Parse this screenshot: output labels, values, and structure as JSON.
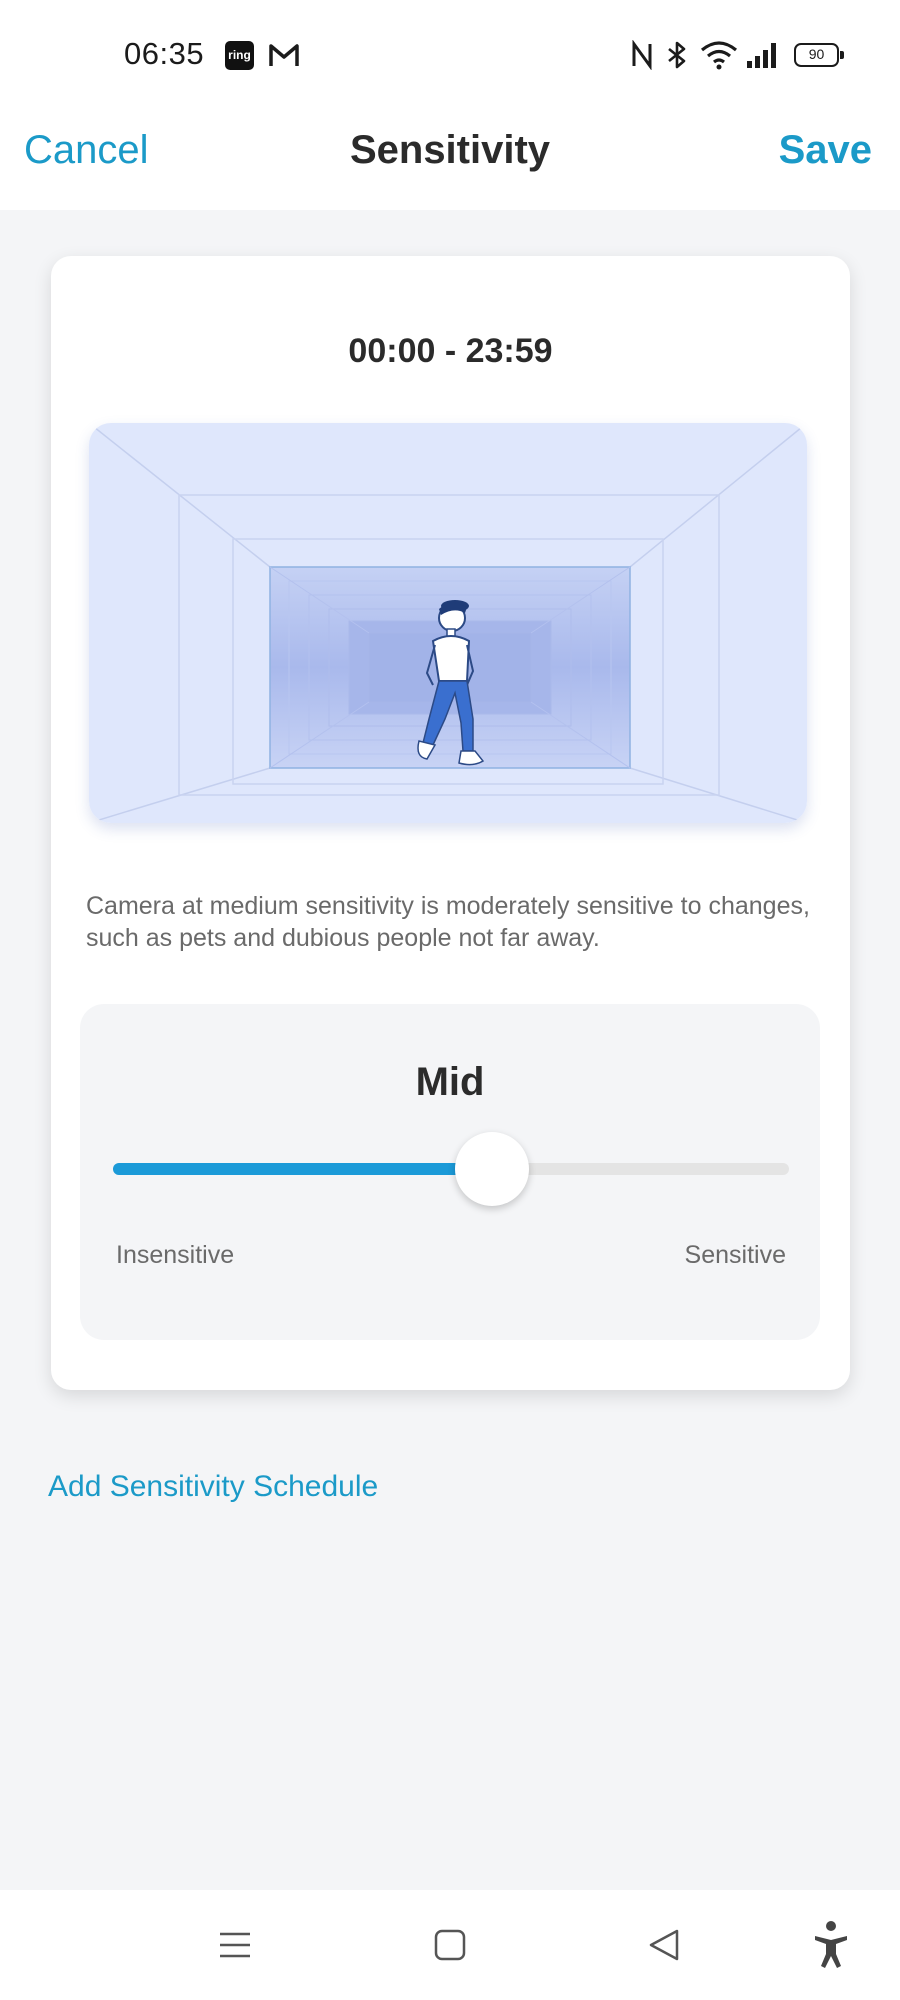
{
  "status_bar": {
    "time": "06:35",
    "notifications": [
      "ring-icon",
      "gmail-icon"
    ],
    "system_icons": [
      "nfc-icon",
      "bluetooth-icon",
      "wifi-icon",
      "signal-icon"
    ],
    "battery": "90"
  },
  "header": {
    "cancel_label": "Cancel",
    "title": "Sensitivity",
    "save_label": "Save"
  },
  "card": {
    "time_range": "00:00 - 23:59",
    "illustration": "person-walking-in-corridor",
    "description": "Camera at medium sensitivity is moderately sensitive to changes, such as pets and dubious people not far away.",
    "slider": {
      "level_label": "Mid",
      "value_fraction": 0.56,
      "min_label": "Insensitive",
      "max_label": "Sensitive"
    }
  },
  "add_schedule_label": "Add Sensitivity Schedule",
  "nav_bar": [
    "menu-icon",
    "home-icon",
    "back-icon",
    "accessibility-icon"
  ],
  "colors": {
    "accent": "#1b9ac8",
    "slider_fill": "#1b9ad8",
    "background": "#f4f5f7",
    "illustration_bg": "#dfe7fc"
  }
}
